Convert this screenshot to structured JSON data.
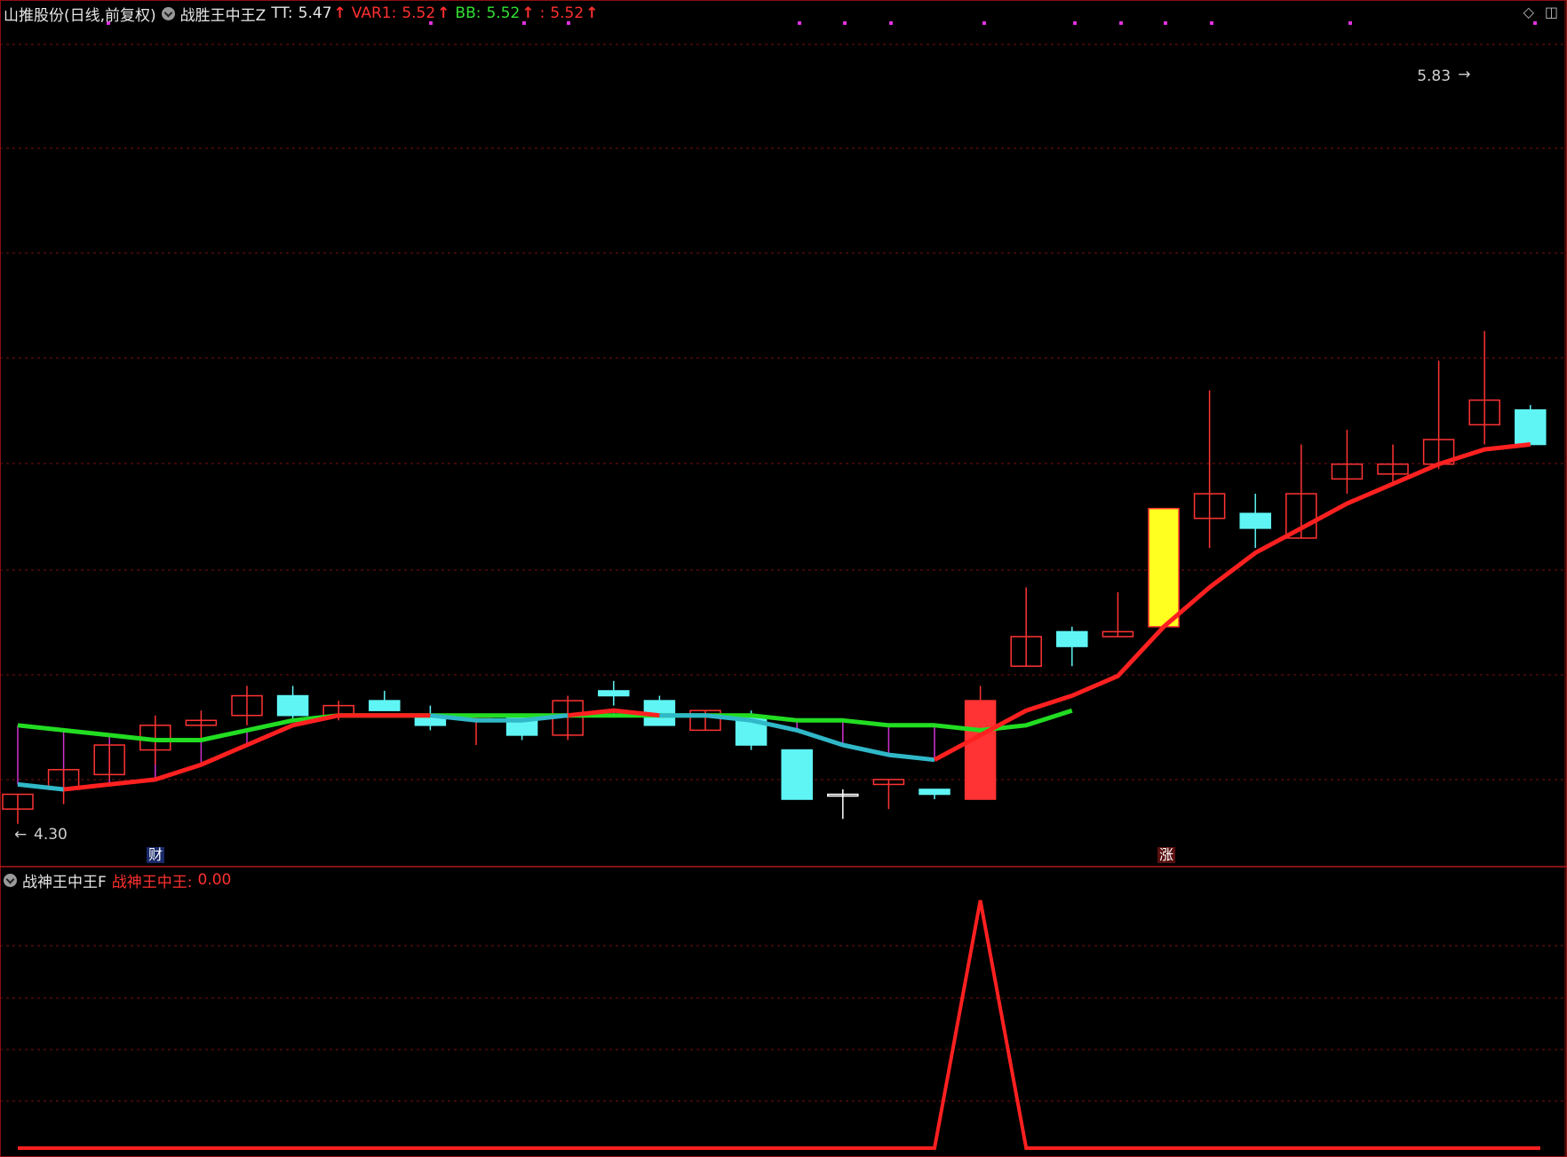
{
  "header": {
    "stock_title": "山推股份(日线,前复权)",
    "indicator_name": "战胜王中王Z",
    "tt_label": "TT:",
    "tt_value": "5.47",
    "var1_label": "VAR1:",
    "var1_value": "5.52",
    "bb_label": "BB:",
    "bb_value": "5.52",
    "extra_label": ":",
    "extra_value": "5.52",
    "up_arrow": "↑"
  },
  "sub_header": {
    "indicator_name": "战神王中王F",
    "value_label": "战神王中王:",
    "value": "0.00"
  },
  "icons": {
    "diamond": "◇",
    "window": "◫"
  },
  "colors": {
    "up": "#ff3333",
    "down": "#5ff5f5",
    "yellow": "#ffff20",
    "green_line": "#22dd22",
    "cyan_line": "#30b8c8",
    "red_line": "#ff2020",
    "magenta": "#d030d0",
    "grid": "#7a1010"
  },
  "chart_data": {
    "type": "candlestick",
    "price_range": [
      4.26,
      5.9
    ],
    "labels": {
      "low_marker": "4.30",
      "high_marker": "5.83",
      "tag_cai": "财",
      "tag_zhang": "涨"
    },
    "candles": [
      {
        "o": 4.33,
        "h": 4.35,
        "l": 4.3,
        "c": 4.36,
        "kind": "up"
      },
      {
        "o": 4.37,
        "h": 4.41,
        "l": 4.34,
        "c": 4.41,
        "kind": "up"
      },
      {
        "o": 4.4,
        "h": 4.46,
        "l": 4.39,
        "c": 4.46,
        "kind": "up"
      },
      {
        "o": 4.45,
        "h": 4.52,
        "l": 4.42,
        "c": 4.5,
        "kind": "up"
      },
      {
        "o": 4.5,
        "h": 4.53,
        "l": 4.47,
        "c": 4.51,
        "kind": "up"
      },
      {
        "o": 4.52,
        "h": 4.58,
        "l": 4.5,
        "c": 4.56,
        "kind": "up"
      },
      {
        "o": 4.56,
        "h": 4.58,
        "l": 4.51,
        "c": 4.52,
        "kind": "down"
      },
      {
        "o": 4.52,
        "h": 4.55,
        "l": 4.51,
        "c": 4.54,
        "kind": "up"
      },
      {
        "o": 4.55,
        "h": 4.57,
        "l": 4.53,
        "c": 4.53,
        "kind": "down"
      },
      {
        "o": 4.52,
        "h": 4.54,
        "l": 4.49,
        "c": 4.5,
        "kind": "down"
      },
      {
        "o": 4.52,
        "h": 4.52,
        "l": 4.46,
        "c": 4.52,
        "kind": "up"
      },
      {
        "o": 4.52,
        "h": 4.52,
        "l": 4.47,
        "c": 4.48,
        "kind": "down"
      },
      {
        "o": 4.48,
        "h": 4.56,
        "l": 4.47,
        "c": 4.55,
        "kind": "up"
      },
      {
        "o": 4.57,
        "h": 4.59,
        "l": 4.54,
        "c": 4.56,
        "kind": "down"
      },
      {
        "o": 4.55,
        "h": 4.56,
        "l": 4.5,
        "c": 4.5,
        "kind": "down"
      },
      {
        "o": 4.49,
        "h": 4.53,
        "l": 4.49,
        "c": 4.53,
        "kind": "up"
      },
      {
        "o": 4.52,
        "h": 4.53,
        "l": 4.45,
        "c": 4.46,
        "kind": "down"
      },
      {
        "o": 4.45,
        "h": 4.45,
        "l": 4.35,
        "c": 4.35,
        "kind": "down"
      },
      {
        "o": 4.36,
        "h": 4.37,
        "l": 4.31,
        "c": 4.36,
        "kind": "doji"
      },
      {
        "o": 4.38,
        "h": 4.39,
        "l": 4.33,
        "c": 4.39,
        "kind": "up"
      },
      {
        "o": 4.37,
        "h": 4.36,
        "l": 4.35,
        "c": 4.36,
        "kind": "down"
      },
      {
        "o": 4.35,
        "h": 4.58,
        "l": 4.35,
        "c": 4.55,
        "kind": "limit_up"
      },
      {
        "o": 4.62,
        "h": 4.78,
        "l": 4.62,
        "c": 4.68,
        "kind": "up"
      },
      {
        "o": 4.69,
        "h": 4.7,
        "l": 4.62,
        "c": 4.66,
        "kind": "down"
      },
      {
        "o": 4.68,
        "h": 4.77,
        "l": 4.68,
        "c": 4.69,
        "kind": "up"
      },
      {
        "o": 4.7,
        "h": 4.94,
        "l": 4.7,
        "c": 4.94,
        "kind": "limit_up_yellow"
      },
      {
        "o": 4.92,
        "h": 5.18,
        "l": 4.86,
        "c": 4.97,
        "kind": "up"
      },
      {
        "o": 4.93,
        "h": 4.97,
        "l": 4.86,
        "c": 4.9,
        "kind": "down"
      },
      {
        "o": 4.88,
        "h": 5.07,
        "l": 4.88,
        "c": 4.97,
        "kind": "up"
      },
      {
        "o": 5.0,
        "h": 5.1,
        "l": 4.97,
        "c": 5.03,
        "kind": "up"
      },
      {
        "o": 5.01,
        "h": 5.07,
        "l": 4.99,
        "c": 5.03,
        "kind": "up"
      },
      {
        "o": 5.03,
        "h": 5.24,
        "l": 5.02,
        "c": 5.08,
        "kind": "up"
      },
      {
        "o": 5.11,
        "h": 5.3,
        "l": 5.07,
        "c": 5.16,
        "kind": "up"
      },
      {
        "o": 5.14,
        "h": 5.15,
        "l": 5.07,
        "c": 5.07,
        "kind": "down"
      }
    ],
    "series": [
      {
        "values": [
          4.5,
          4.49,
          4.48,
          4.47,
          4.47,
          4.49,
          4.51,
          4.52,
          4.52,
          4.52,
          4.52,
          4.52,
          4.52,
          4.52,
          4.52,
          4.52,
          4.52,
          4.51,
          4.51,
          4.5,
          4.5,
          4.49,
          4.5,
          4.53,
          4.55,
          4.58,
          4.62,
          4.68,
          4.74,
          4.82,
          4.88,
          4.95,
          5.01,
          5.06
        ]
      },
      {
        "values": [
          4.38,
          4.37,
          4.38,
          4.39,
          4.42,
          4.46,
          4.5,
          4.52,
          4.52,
          4.52,
          4.51,
          4.51,
          4.52,
          4.53,
          4.52,
          4.52,
          4.51,
          4.49,
          4.46,
          4.44,
          4.43,
          4.48,
          4.53,
          4.56,
          4.6,
          4.7,
          4.78,
          4.85,
          4.9,
          4.95,
          4.99,
          5.03,
          5.06,
          5.07
        ]
      }
    ],
    "lower_panel": {
      "range": [
        0,
        1.05
      ],
      "values": [
        0,
        0,
        0,
        0,
        0,
        0,
        0,
        0,
        0,
        0,
        0,
        0,
        0,
        0,
        0,
        0,
        0,
        0,
        0,
        0,
        0,
        1,
        0,
        0,
        0,
        0,
        0,
        0,
        0,
        0,
        0,
        0,
        0,
        0
      ]
    }
  }
}
